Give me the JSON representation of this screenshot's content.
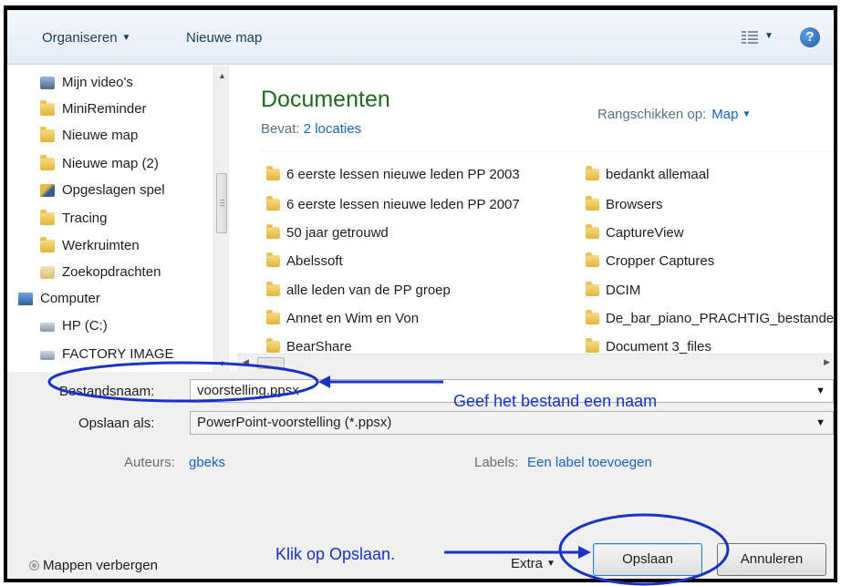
{
  "toolbar": {
    "organise_label": "Organiseren",
    "new_folder_label": "Nieuwe map",
    "help_glyph": "?"
  },
  "nav": {
    "items": [
      {
        "label": "Mijn video's",
        "icon": "video-folder-icon"
      },
      {
        "label": "MiniReminder",
        "icon": "folder-icon"
      },
      {
        "label": "Nieuwe map",
        "icon": "folder-icon"
      },
      {
        "label": "Nieuwe map (2)",
        "icon": "folder-icon"
      },
      {
        "label": "Opgeslagen spel",
        "icon": "saved-games-icon"
      },
      {
        "label": "Tracing",
        "icon": "folder-icon"
      },
      {
        "label": "Werkruimten",
        "icon": "folder-icon"
      },
      {
        "label": "Zoekopdrachten",
        "icon": "search-folder-icon"
      },
      {
        "label": "Computer",
        "icon": "computer-icon"
      },
      {
        "label": "HP (C:)",
        "icon": "drive-icon"
      },
      {
        "label": "FACTORY IMAGE",
        "icon": "drive-icon"
      }
    ]
  },
  "library": {
    "title": "Documenten",
    "contains_label": "Bevat:",
    "contains_link": "2 locaties",
    "arrange_label": "Rangschikken op:",
    "arrange_value": "Map"
  },
  "files": {
    "column1": [
      "6 eerste lessen nieuwe leden PP 2003",
      "6 eerste lessen nieuwe leden PP 2007",
      "50 jaar getrouwd",
      "Abelssoft",
      "alle leden van de PP groep",
      "Annet en Wim en Von",
      "BearShare"
    ],
    "column2": [
      "bedankt allemaal",
      "Browsers",
      "CaptureView",
      "Cropper Captures",
      "DCIM",
      "De_bar_piano_PRACHTIG_bestanden",
      "Document 3_files"
    ]
  },
  "form": {
    "filename_label": "Bestandsnaam:",
    "filename_value": "voorstelling.ppsx",
    "saveas_label": "Opslaan als:",
    "saveas_value": "PowerPoint-voorstelling (*.ppsx)",
    "authors_label": "Auteurs:",
    "authors_value": "gbeks",
    "tags_label": "Labels:",
    "tags_value": "Een label toevoegen"
  },
  "footer": {
    "hide_folders_label": "Mappen verbergen",
    "extra_label": "Extra",
    "save_label": "Opslaan",
    "cancel_label": "Annuleren"
  },
  "annotations": {
    "name_hint": "Geef het bestand een naam",
    "click_hint": "Klik op Opslaan."
  },
  "colors": {
    "annotation": "#1a31c8",
    "library_title": "#1e6b1e",
    "link": "#1a62c0"
  }
}
